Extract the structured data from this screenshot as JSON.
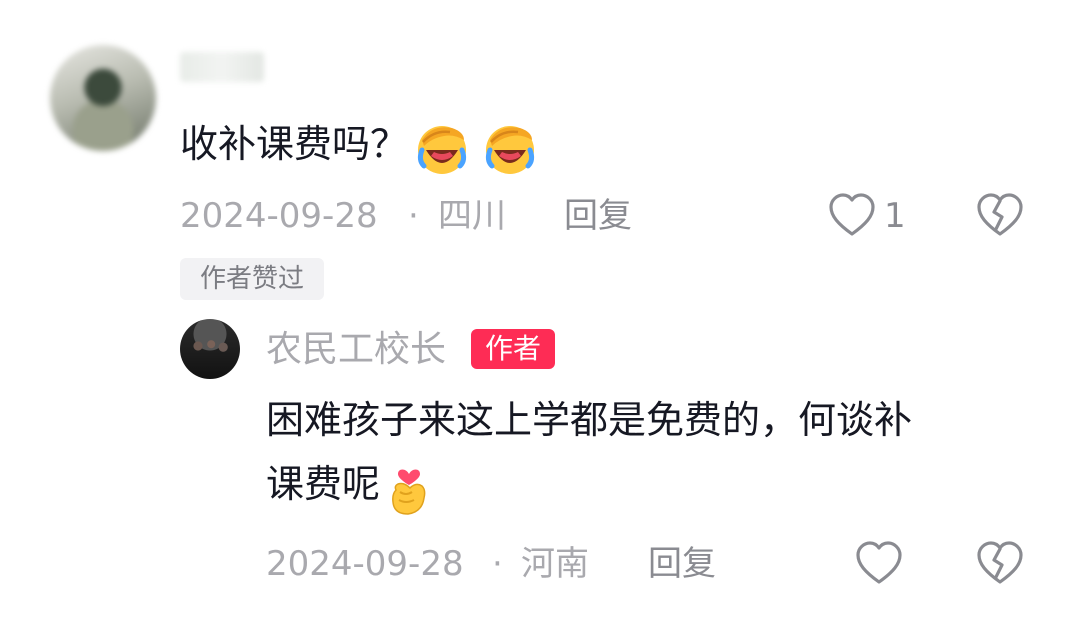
{
  "comment": {
    "text": "收补课费吗？",
    "emojis": [
      "facepalm-laugh-emoji",
      "facepalm-laugh-emoji"
    ],
    "date": "2024-09-28",
    "separator": "·",
    "location": "四川",
    "reply_label": "回复",
    "like_count": "1",
    "author_liked_badge": "作者赞过"
  },
  "reply": {
    "author_name": "农民工校长",
    "author_badge": "作者",
    "text_part1": "困难孩子来这上学都是免费的，何谈补",
    "text_part2": "课费呢",
    "emoji": "finger-heart-emoji",
    "date": "2024-09-28",
    "separator": "·",
    "location": "河南",
    "reply_label": "回复"
  },
  "colors": {
    "primary_text": "#161823",
    "secondary_text": "#a9a9ae",
    "author_badge_bg": "#fe2c55",
    "badge_bg": "#f2f2f4"
  }
}
